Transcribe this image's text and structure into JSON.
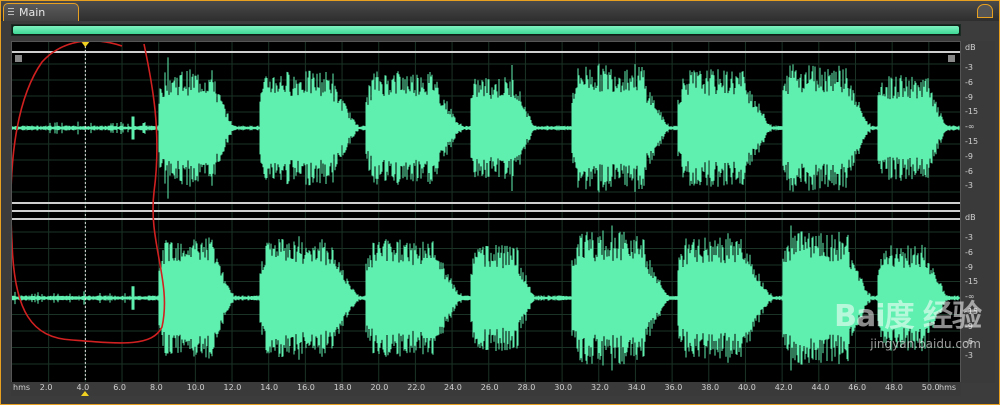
{
  "panel": {
    "tab_label": "Main"
  },
  "waveform": {
    "color": "#5ff0b0",
    "background": "#000000",
    "grid_color": "#1a3326",
    "annotation_color": "#d02020"
  },
  "db_ruler": {
    "unit": "dB",
    "channel1": [
      "-3",
      "-6",
      "-9",
      "-15",
      "-∞",
      "-15",
      "-9",
      "-6",
      "-3"
    ],
    "channel2": [
      "-3",
      "-6",
      "-9",
      "-15",
      "-∞",
      "-15",
      "-9",
      "-6",
      "-3"
    ]
  },
  "timeline": {
    "unit_left": "hms",
    "unit_right": "hms",
    "ticks": [
      "2.0",
      "4.0",
      "6.0",
      "8.0",
      "10.0",
      "12.0",
      "14.0",
      "16.0",
      "18.0",
      "20.0",
      "22.0",
      "24.0",
      "26.0",
      "28.0",
      "30.0",
      "32.0",
      "34.0",
      "36.0",
      "38.0",
      "40.0",
      "42.0",
      "44.0",
      "46.0",
      "48.0",
      "50.0"
    ],
    "playhead_seconds": 4.0
  },
  "watermark": {
    "logo": "Bai度 经验",
    "url": "jingyan.baidu.com"
  }
}
